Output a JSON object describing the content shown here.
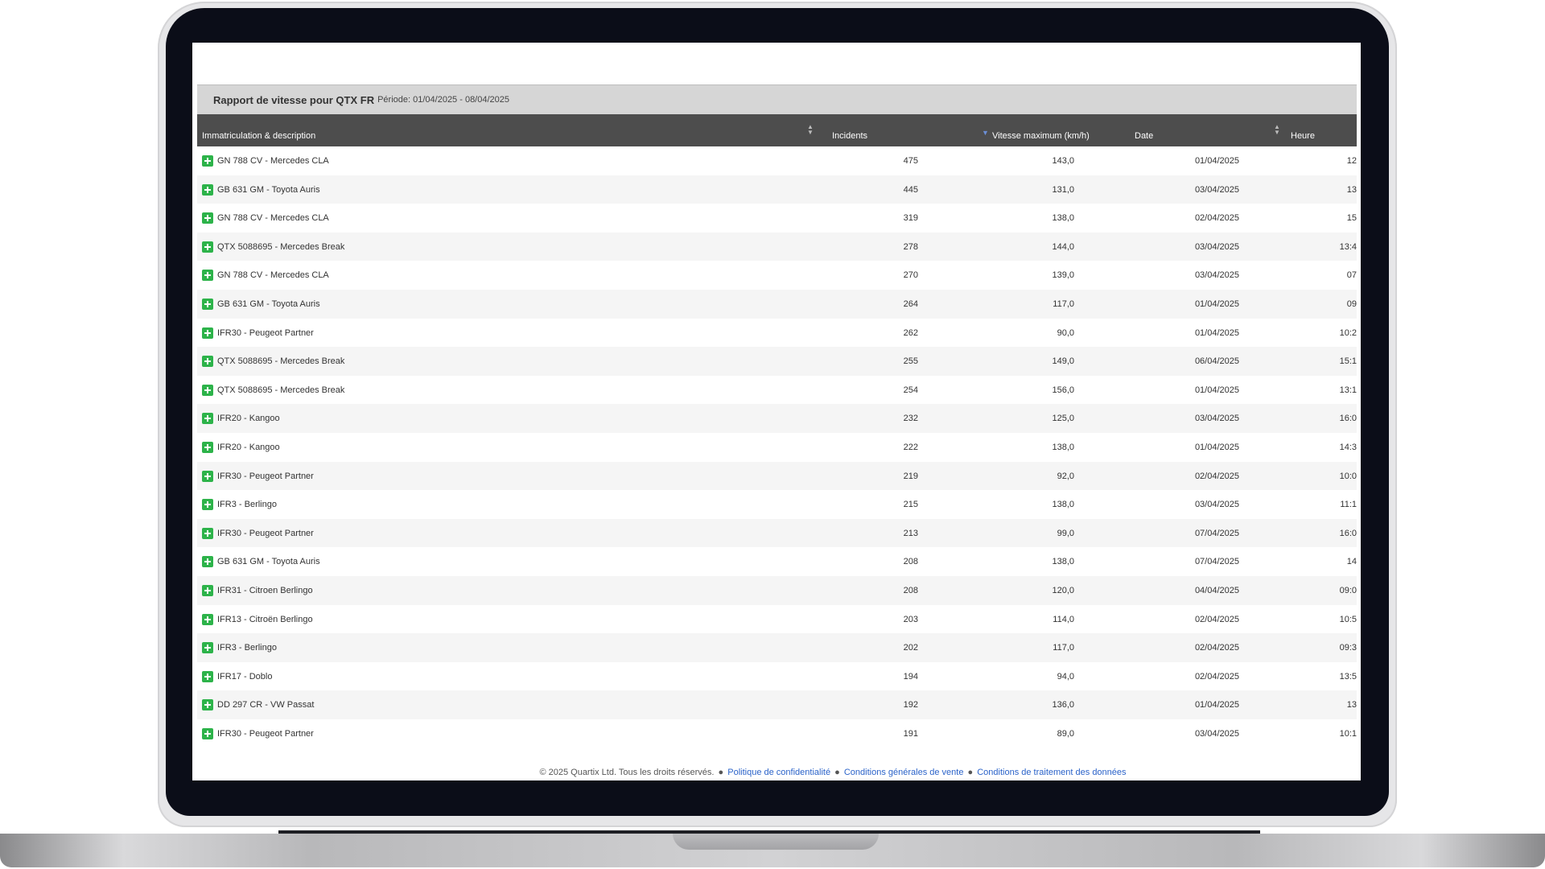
{
  "report": {
    "title": "Rapport de vitesse pour QTX FR",
    "period": "Période: 01/04/2025 - 08/04/2025"
  },
  "table": {
    "headers": {
      "description": "Immatriculation & description",
      "incidents": "Incidents",
      "max_speed": "Vitesse maximum (km/h)",
      "date": "Date",
      "time": "Heure"
    },
    "rows": [
      {
        "desc": "GN 788 CV - Mercedes CLA",
        "incidents": "475",
        "speed": "143,0",
        "date": "01/04/2025",
        "time": "12"
      },
      {
        "desc": "GB 631 GM - Toyota Auris",
        "incidents": "445",
        "speed": "131,0",
        "date": "03/04/2025",
        "time": "13"
      },
      {
        "desc": "GN 788 CV - Mercedes CLA",
        "incidents": "319",
        "speed": "138,0",
        "date": "02/04/2025",
        "time": "15"
      },
      {
        "desc": "QTX 5088695 - Mercedes Break",
        "incidents": "278",
        "speed": "144,0",
        "date": "03/04/2025",
        "time": "13:4"
      },
      {
        "desc": "GN 788 CV - Mercedes CLA",
        "incidents": "270",
        "speed": "139,0",
        "date": "03/04/2025",
        "time": "07"
      },
      {
        "desc": "GB 631 GM - Toyota Auris",
        "incidents": "264",
        "speed": "117,0",
        "date": "01/04/2025",
        "time": "09"
      },
      {
        "desc": "IFR30 - Peugeot Partner",
        "incidents": "262",
        "speed": "90,0",
        "date": "01/04/2025",
        "time": "10:2"
      },
      {
        "desc": "QTX 5088695 - Mercedes Break",
        "incidents": "255",
        "speed": "149,0",
        "date": "06/04/2025",
        "time": "15:1"
      },
      {
        "desc": "QTX 5088695 - Mercedes Break",
        "incidents": "254",
        "speed": "156,0",
        "date": "01/04/2025",
        "time": "13:1"
      },
      {
        "desc": "IFR20 - Kangoo",
        "incidents": "232",
        "speed": "125,0",
        "date": "03/04/2025",
        "time": "16:0"
      },
      {
        "desc": "IFR20 - Kangoo",
        "incidents": "222",
        "speed": "138,0",
        "date": "01/04/2025",
        "time": "14:3"
      },
      {
        "desc": "IFR30 - Peugeot Partner",
        "incidents": "219",
        "speed": "92,0",
        "date": "02/04/2025",
        "time": "10:0"
      },
      {
        "desc": "IFR3 - Berlingo",
        "incidents": "215",
        "speed": "138,0",
        "date": "03/04/2025",
        "time": "11:1"
      },
      {
        "desc": "IFR30 - Peugeot Partner",
        "incidents": "213",
        "speed": "99,0",
        "date": "07/04/2025",
        "time": "16:0"
      },
      {
        "desc": "GB 631 GM - Toyota Auris",
        "incidents": "208",
        "speed": "138,0",
        "date": "07/04/2025",
        "time": "14"
      },
      {
        "desc": "IFR31 - Citroen Berlingo",
        "incidents": "208",
        "speed": "120,0",
        "date": "04/04/2025",
        "time": "09:0"
      },
      {
        "desc": "IFR13 - Citroën Berlingo",
        "incidents": "203",
        "speed": "114,0",
        "date": "02/04/2025",
        "time": "10:5"
      },
      {
        "desc": "IFR3 - Berlingo",
        "incidents": "202",
        "speed": "117,0",
        "date": "02/04/2025",
        "time": "09:3"
      },
      {
        "desc": "IFR17 - Doblo",
        "incidents": "194",
        "speed": "94,0",
        "date": "02/04/2025",
        "time": "13:5"
      },
      {
        "desc": "DD 297 CR - VW Passat",
        "incidents": "192",
        "speed": "136,0",
        "date": "01/04/2025",
        "time": "13"
      },
      {
        "desc": "IFR30 - Peugeot Partner",
        "incidents": "191",
        "speed": "89,0",
        "date": "03/04/2025",
        "time": "10:1"
      }
    ]
  },
  "footer": {
    "copyright": "© 2025 Quartix Ltd. Tous les droits réservés.",
    "privacy": "Politique de confidentialité",
    "terms": "Conditions générales de vente",
    "data_processing": "Conditions de traitement des données"
  },
  "icons": {
    "row_expand": "plus-square-icon",
    "sort": "sort-arrows-icon",
    "sort_active": "sort-desc-icon"
  },
  "colors": {
    "table_header_bg": "#4d4d4d",
    "report_header_bg": "#d6d6d6",
    "expand_icon": "#2db34a",
    "link": "#2b63c9",
    "sort_active": "#6b8fd6"
  }
}
